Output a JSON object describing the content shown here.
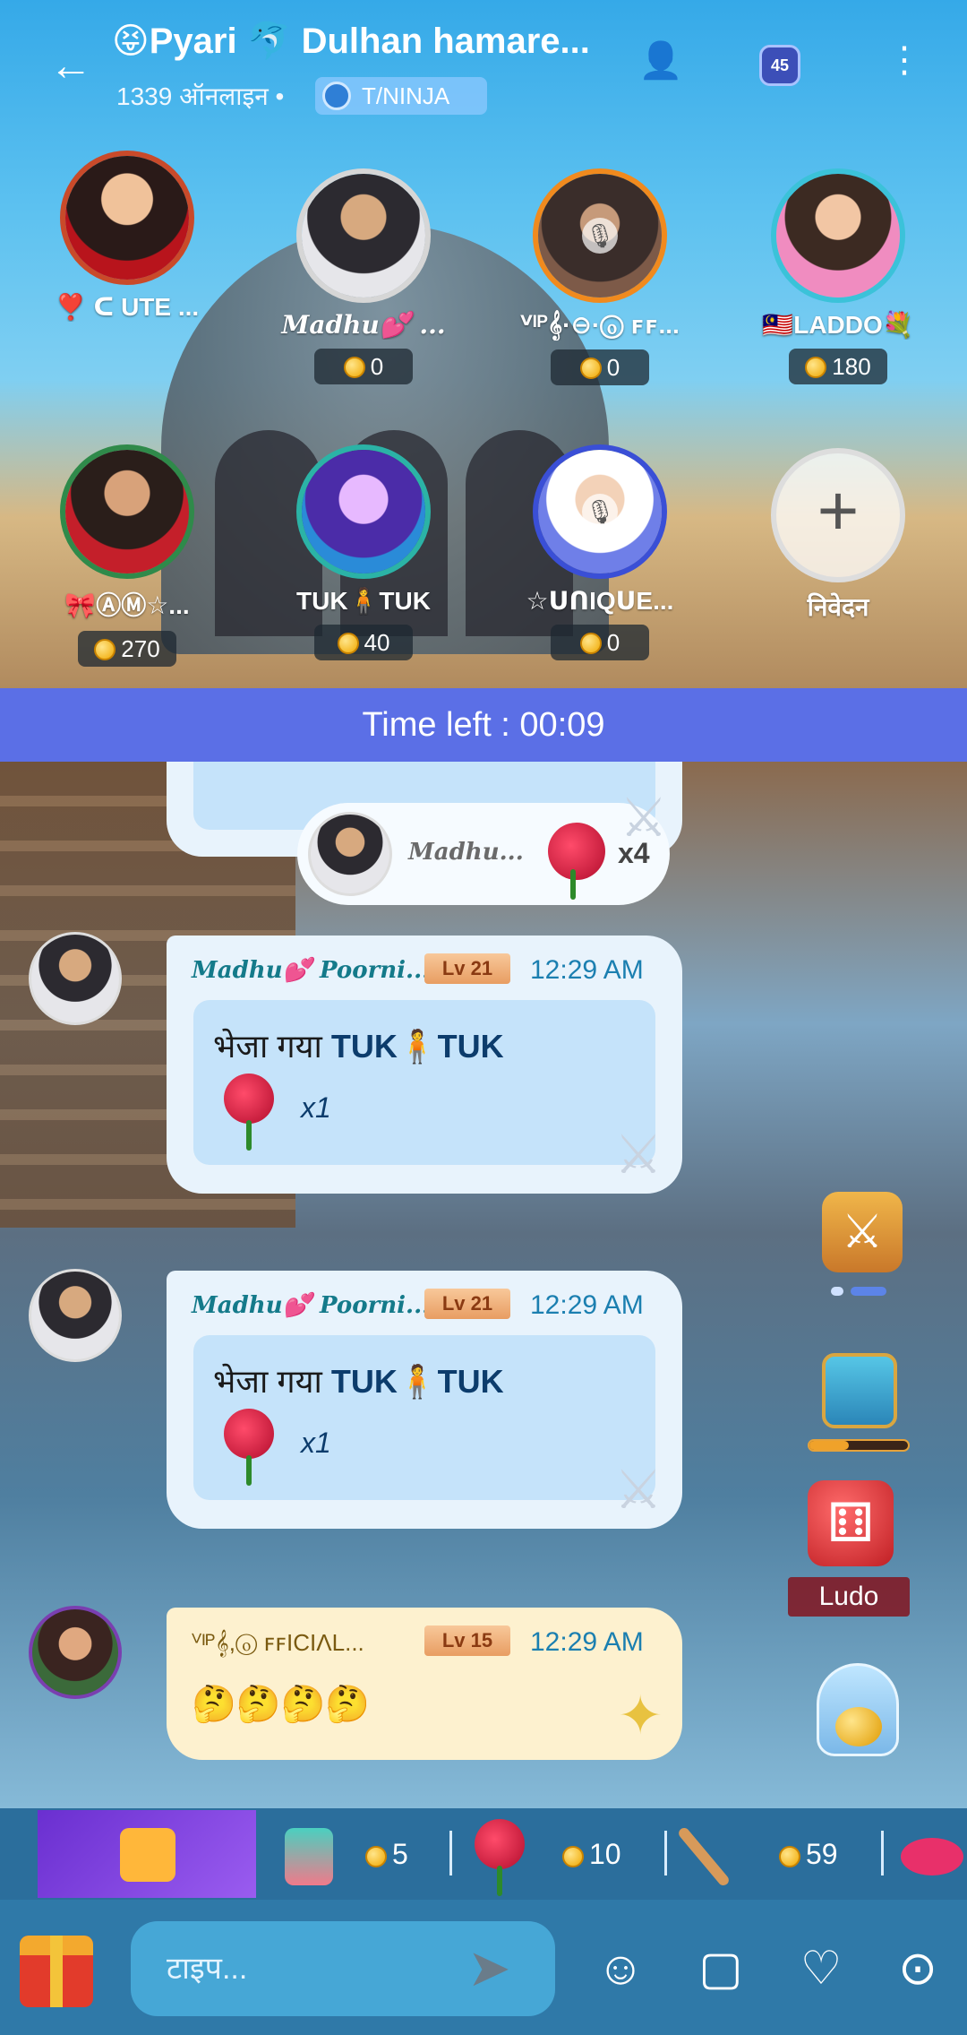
{
  "header": {
    "back_icon": "arrow-left-icon",
    "title": "😝Pyari 🐬 Dulhan hamare...",
    "online": "1339 ऑनलाइन •",
    "tag": "T/NINJA",
    "level": "45"
  },
  "seats": [
    {
      "name": "❣️ ᑕ UTE ...",
      "score": null
    },
    {
      "name": "Madhu💕 ...",
      "score": "0"
    },
    {
      "name": "ⱽᴵᴾ𝄞·⊖·ⓞ ꜰꜰ...",
      "score": "0"
    },
    {
      "name": "🇲🇾LADDO💐",
      "score": "180"
    },
    {
      "name": "🎀ⒶⓂ☆...",
      "score": "270"
    },
    {
      "name": "TUK🧍TUK",
      "score": "40"
    },
    {
      "name": "☆ᑌᑎIQᑌE...",
      "score": "0"
    },
    {
      "name": "निवेदन",
      "score": null
    }
  ],
  "timer": "Time left : 00:09",
  "chat": {
    "pill": {
      "sender": "Madhu...",
      "count": "x4"
    },
    "messages": [
      {
        "sender": "Madhu💕 Poorni...",
        "level": "Lv 21",
        "time": "12:29 AM",
        "text_prefix": "भेजा गया ",
        "text_target": "TUK🧍TUK",
        "gift_count": "x1"
      },
      {
        "sender": "Madhu💕 Poorni...",
        "level": "Lv 21",
        "time": "12:29 AM",
        "text_prefix": "भेजा गया ",
        "text_target": "TUK🧍TUK",
        "gift_count": "x1"
      },
      {
        "sender": "ⱽᴵᴾ𝄞,ⓞ ꜰꜰICIΛL...",
        "level": "Lv 15",
        "time": "12:29 AM",
        "text": "🤔🤔🤔🤔"
      }
    ]
  },
  "side": {
    "ludo_label": "Ludo"
  },
  "gift_bar": [
    {
      "icon": "hi-gift-icon",
      "price": "5"
    },
    {
      "icon": "rose-icon",
      "price": "10"
    },
    {
      "icon": "rolling-pin-icon",
      "price": "59"
    }
  ],
  "input": {
    "placeholder": "टाइप..."
  },
  "colors": {
    "timer_bg": "#5b6fe6",
    "bubble_bg": "#e8f3fc",
    "gift_bar_bg": "#2b6e9c",
    "input_bar_bg": "#2f79a8"
  }
}
